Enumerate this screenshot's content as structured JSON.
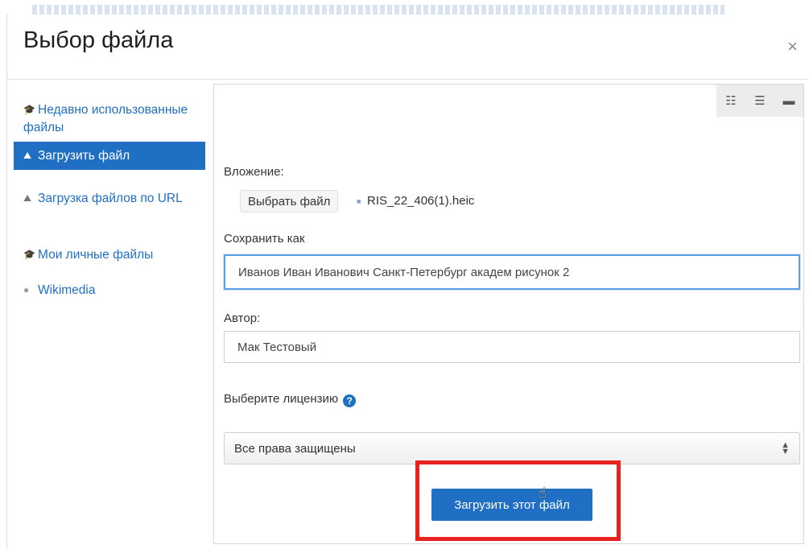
{
  "dialog": {
    "title": "Выбор файла",
    "close_label": "×"
  },
  "sidebar": {
    "items": [
      {
        "label": "Недавно использованные файлы",
        "icon": "moodle-hat-icon",
        "active": false
      },
      {
        "label": "Загрузить файл",
        "icon": "upload-icon",
        "active": true
      },
      {
        "label": "Загрузка файлов по URL",
        "icon": "url-download-icon",
        "active": false
      },
      {
        "label": "Мои личные файлы",
        "icon": "moodle-hat-icon",
        "active": false
      },
      {
        "label": "Wikimedia",
        "icon": "globe-icon",
        "active": false
      }
    ]
  },
  "view_toggle": {
    "icons": [
      "grid-view-icon",
      "list-view-icon",
      "folder-view-icon"
    ]
  },
  "form": {
    "attachment_label": "Вложение:",
    "choose_button": "Выбрать файл",
    "file_name": "RIS_22_406(1).heic",
    "save_as_label": "Сохранить как",
    "save_as_value": "Иванов Иван Иванович Санкт-Петербург академ рисунок 2",
    "author_label": "Автор:",
    "author_value": "Мак Тестовый",
    "license_label": "Выберите лицензию",
    "license_value": "Все права защищены",
    "upload_button": "Загрузить этот файл"
  },
  "colors": {
    "accent": "#1f6fc4",
    "highlight": "#e8231f",
    "focus": "#5aa0e0"
  }
}
